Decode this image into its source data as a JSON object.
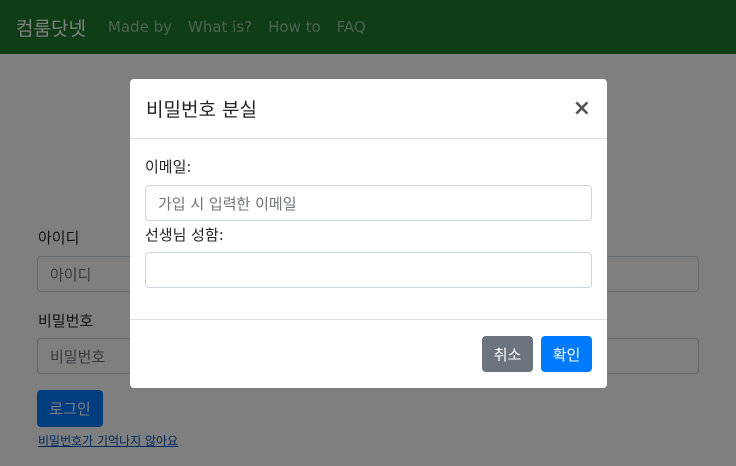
{
  "navbar": {
    "brand": "컴룸닷넷",
    "links": [
      "Made by",
      "What is?",
      "How to",
      "FAQ"
    ],
    "background": "#1f7a2a"
  },
  "login_form": {
    "id_label": "아이디",
    "id_placeholder": "아이디",
    "password_label": "비밀번호",
    "password_placeholder": "비밀번호",
    "login_button": "로그인",
    "forgot_link": "비밀번호가 기억나지 않아요"
  },
  "modal": {
    "title": "비밀번호 분실",
    "close_symbol": "×",
    "email_label": "이메일:",
    "email_placeholder": "가입 시 입력한 이메일",
    "teacher_label": "선생님 성함:",
    "teacher_value": "",
    "cancel_button": "취소",
    "confirm_button": "확인"
  },
  "colors": {
    "primary": "#007bff",
    "secondary": "#6c757d"
  }
}
